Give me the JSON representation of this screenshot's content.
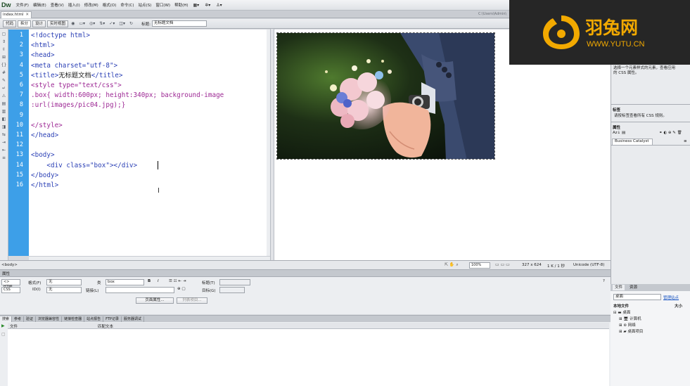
{
  "app": {
    "logo": "Dw"
  },
  "menu": [
    "文件(F)",
    "编辑(E)",
    "查看(V)",
    "插入(I)",
    "修改(M)",
    "格式(O)",
    "命令(C)",
    "站点(S)",
    "窗口(W)",
    "帮助(H)"
  ],
  "menu_icons": [
    "layout-icon",
    "gear-icon",
    "user-icon"
  ],
  "document": {
    "tab_name": "index.html",
    "path": "C:\\Users\\Admin\\",
    "views": [
      "代码",
      "拆分",
      "设计",
      "实时视图"
    ],
    "title_label": "标题:",
    "title_value": "无标题文档"
  },
  "code": {
    "line_numbers": [
      "1",
      "2",
      "3",
      "4",
      "5",
      "6",
      "7",
      "8",
      "9",
      "10",
      "11",
      "12",
      "13",
      "14",
      "15",
      "16"
    ],
    "lines": [
      {
        "segments": [
          {
            "text": "<!doctype html>",
            "color": "blue"
          }
        ]
      },
      {
        "segments": [
          {
            "text": "<html>",
            "color": "blue"
          }
        ]
      },
      {
        "segments": [
          {
            "text": "<head>",
            "color": "blue"
          }
        ]
      },
      {
        "segments": [
          {
            "text": "<meta charset=\"utf-8\">",
            "color": "blue"
          }
        ]
      },
      {
        "segments": [
          {
            "text": "<title>",
            "color": "blue"
          },
          {
            "text": "无标题文档",
            "color": "dark"
          },
          {
            "text": "</title>",
            "color": "blue"
          }
        ]
      },
      {
        "segments": [
          {
            "text": "<style type=\"text/css\">",
            "color": "purple"
          }
        ]
      },
      {
        "segments": [
          {
            "text": ".box{ width:600px; height:340px; background-image",
            "color": "purple"
          }
        ]
      },
      {
        "segments": [
          {
            "text": ":url(images/pic04.jpg);}",
            "color": "purple"
          }
        ]
      },
      {
        "segments": [
          {
            "text": "",
            "color": "dark"
          }
        ]
      },
      {
        "segments": [
          {
            "text": "</style>",
            "color": "purple"
          }
        ]
      },
      {
        "segments": [
          {
            "text": "</head>",
            "color": "blue"
          }
        ]
      },
      {
        "segments": [
          {
            "text": "",
            "color": "dark"
          }
        ]
      },
      {
        "segments": [
          {
            "text": "<body>",
            "color": "blue"
          }
        ]
      },
      {
        "segments": [
          {
            "text": "    <div class=\"box\"></div>",
            "color": "blue"
          }
        ]
      },
      {
        "segments": [
          {
            "text": "</body>",
            "color": "blue"
          }
        ]
      },
      {
        "segments": [
          {
            "text": "</html>",
            "color": "blue"
          }
        ]
      }
    ]
  },
  "colors": {
    "blue": "#2a3fb5",
    "purple": "#9d2894",
    "dark": "#222222",
    "gutter": "#3d9fe8",
    "watermark": "#f2a900"
  },
  "status": {
    "tag": "<body>",
    "zoom": "100%",
    "window_size": "327 x 624",
    "page_info": "1 K / 1 秒",
    "encoding": "Unicode (UTF-8)"
  },
  "properties": {
    "panel_title": "属性",
    "html_btn": "<> HTML",
    "css_btn": "CSS",
    "format_label": "格式(F)",
    "format_value": "无",
    "class_label": "类",
    "class_value": "box",
    "id_label": "ID(I)",
    "id_value": "无",
    "link_label": "链接(L)",
    "title_label": "标题(T)",
    "target_label": "目标(G)",
    "page_props_btn": "页面属性...",
    "list_item_btn": "列表项目..."
  },
  "results": {
    "tabs": [
      "搜索",
      "参考",
      "验证",
      "浏览器兼容性",
      "链接检查器",
      "站点报告",
      "FTP记录",
      "服务器调试"
    ],
    "col_file": "文件",
    "col_text": "匹配文本"
  },
  "right_panel": {
    "css_hint_line1": "选择一个元素样式的元素，查看应用",
    "css_hint_line2": "的 CSS 属性。",
    "tag_section": "标签",
    "tag_hint": "请按标签查看所有 CSS 规则。",
    "props_section": "属性",
    "bc_tab": "Business Catalyst",
    "files_tab": "文件",
    "assets_tab": "资源",
    "site_select": "桌面",
    "manage_sites": "管理站点",
    "local_files": "本地文件",
    "size_col": "大小",
    "tree": [
      "桌面",
      "计算机",
      "网络",
      "桌面项目"
    ]
  },
  "watermark": {
    "text": "羽兔网",
    "url": "WWW.YUTU.CN"
  }
}
